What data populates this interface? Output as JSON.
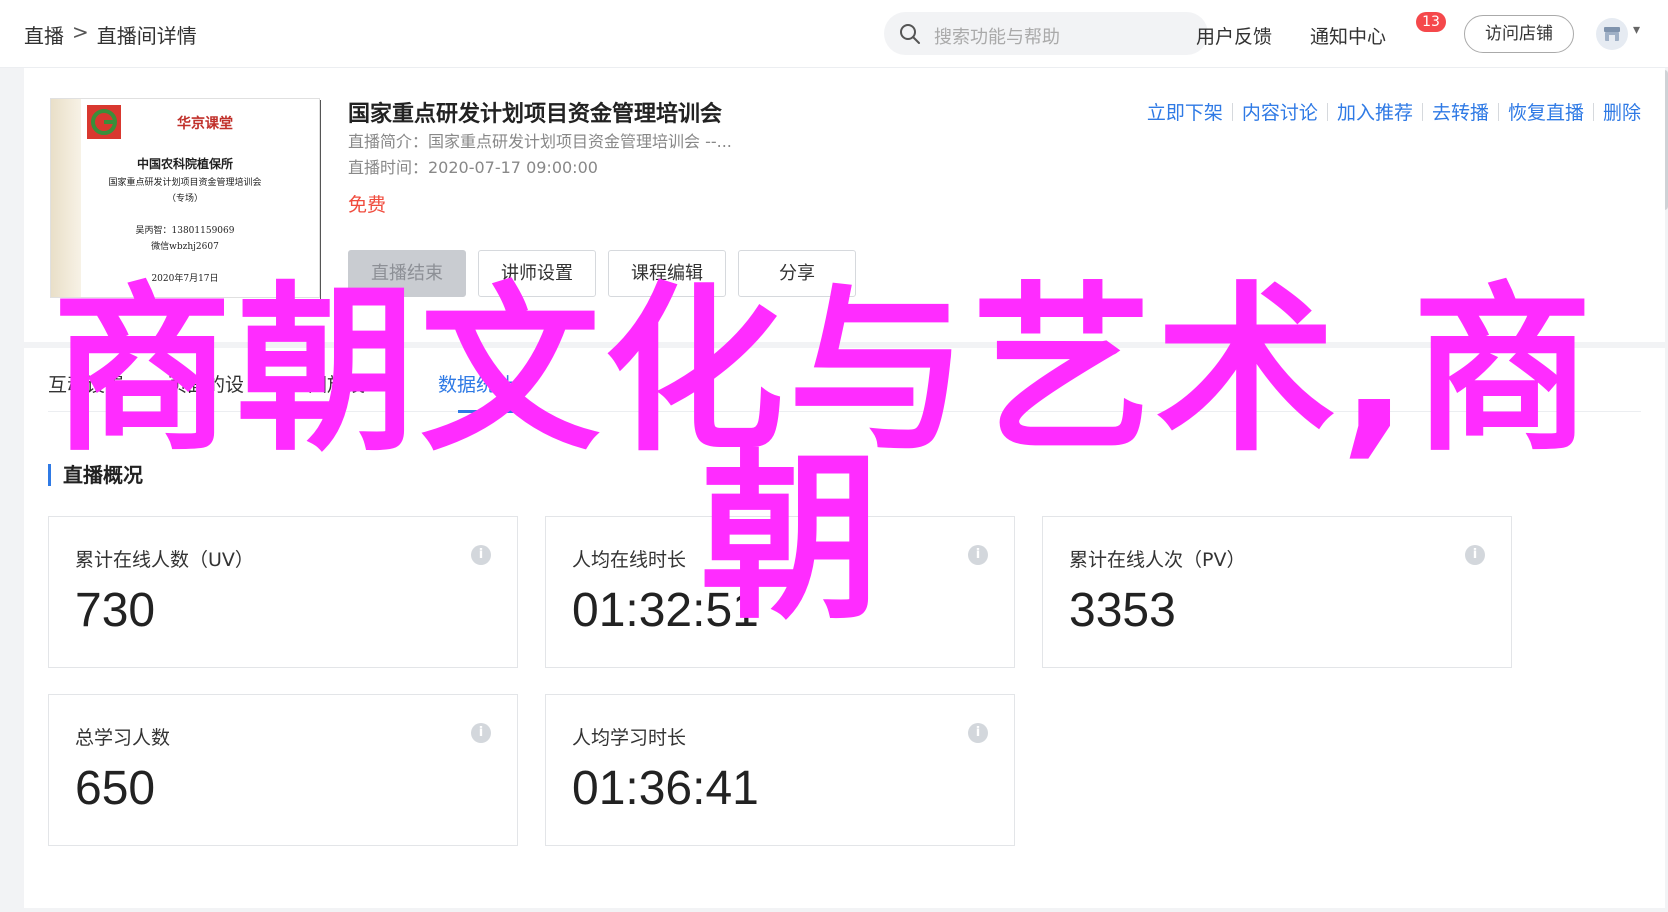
{
  "header": {
    "breadcrumb": [
      "直播",
      ">",
      "直播间详情"
    ],
    "search_placeholder": "搜索功能与帮助",
    "feedback": "用户反馈",
    "notifications": "通知中心",
    "notification_count": "13",
    "visit_store": "访问店铺"
  },
  "course": {
    "title": "国家重点研发计划项目资金管理培训会",
    "intro": "直播简介：国家重点研发计划项目资金管理培训会 --...",
    "time": "直播时间：2020-07-17 09:00:00",
    "price": "免费",
    "cover": {
      "brand": "华京课堂",
      "org": "中国农科院植保所",
      "line1": "国家重点研发计划项目资金管理培训会",
      "line2": "（专场）",
      "contact1": "吴丙智：13801159069",
      "contact2": "微信wbzhj2607",
      "date": "2020年7月17日"
    },
    "buttons": [
      "直播结束",
      "讲师设置",
      "课程编辑",
      "分享"
    ],
    "actions": [
      "立即下架",
      "内容讨论",
      "加入推荐",
      "去转播",
      "恢复直播",
      "删除"
    ]
  },
  "tabs": [
    "互动设置",
    "页面的设",
    "回放设",
    "数据统计"
  ],
  "section_title": "直播概况",
  "stats": [
    {
      "label": "累计在线人数（UV）",
      "value": "730"
    },
    {
      "label": "人均在线时长",
      "value": "01:32:51"
    },
    {
      "label": "累计在线人次（PV）",
      "value": "3353"
    },
    {
      "label": "总学习人数",
      "value": "650"
    },
    {
      "label": "人均学习时长",
      "value": "01:36:41"
    }
  ],
  "overlay": {
    "line1": "商朝文化与艺术,商",
    "line2": "朝"
  },
  "colors": {
    "accent": "#2f7ae5",
    "price": "#f04c3e",
    "overlay": "#ff2cff",
    "badge": "#f5484b"
  }
}
